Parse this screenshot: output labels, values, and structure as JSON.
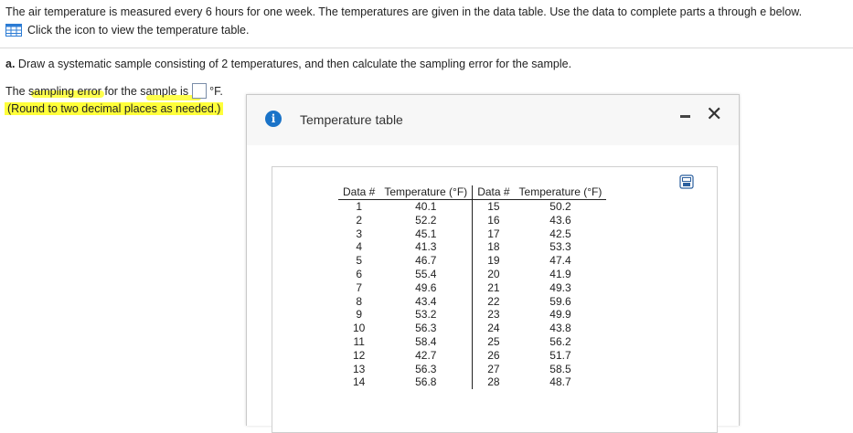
{
  "problem": {
    "intro": "The air temperature is measured every 6 hours for one week. The temperatures are given in the data table. Use the data to complete parts a through e below.",
    "table_link": "Click the icon to view the temperature table.",
    "part_label": "a.",
    "part_text": "Draw a systematic sample consisting of 2 temperatures, and then calculate the sampling error for the sample.",
    "answer_prefix": "The sampling error for the sample is",
    "answer_value": "",
    "answer_suffix": "°F.",
    "round_note": "(Round to two decimal places as needed.)"
  },
  "dialog": {
    "title": "Temperature table",
    "headers": [
      "Data #",
      "Temperature (°F)",
      "Data #",
      "Temperature (°F)"
    ],
    "rows": [
      [
        "1",
        "40.1",
        "15",
        "50.2"
      ],
      [
        "2",
        "52.2",
        "16",
        "43.6"
      ],
      [
        "3",
        "45.1",
        "17",
        "42.5"
      ],
      [
        "4",
        "41.3",
        "18",
        "53.3"
      ],
      [
        "5",
        "46.7",
        "19",
        "47.4"
      ],
      [
        "6",
        "55.4",
        "20",
        "41.9"
      ],
      [
        "7",
        "49.6",
        "21",
        "49.3"
      ],
      [
        "8",
        "43.4",
        "22",
        "59.6"
      ],
      [
        "9",
        "53.2",
        "23",
        "49.9"
      ],
      [
        "10",
        "56.3",
        "24",
        "43.8"
      ],
      [
        "11",
        "58.4",
        "25",
        "56.2"
      ],
      [
        "12",
        "42.7",
        "26",
        "51.7"
      ],
      [
        "13",
        "56.3",
        "27",
        "58.5"
      ],
      [
        "14",
        "56.8",
        "28",
        "48.7"
      ]
    ]
  },
  "icons": {
    "table": "table-grid-icon",
    "info": "info-icon",
    "minimize": "minimize-icon",
    "close": "close-icon",
    "copy": "copy-icon"
  },
  "colors": {
    "highlight": "#ffff3a",
    "info_blue": "#1a73c8"
  }
}
